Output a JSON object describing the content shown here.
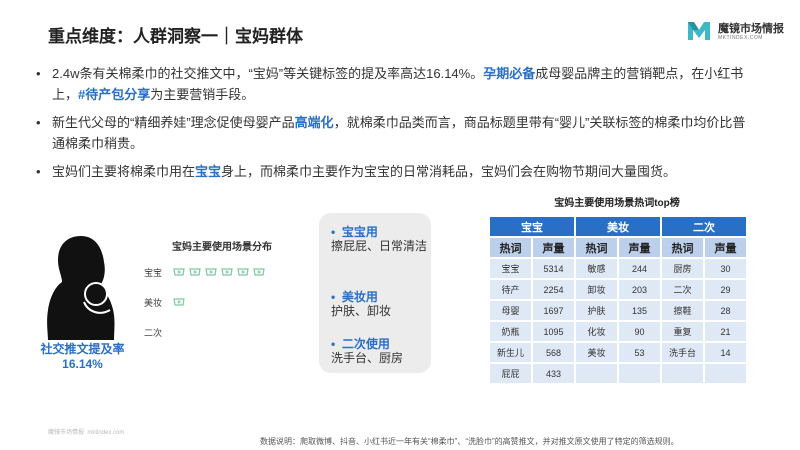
{
  "title": "重点维度：人群洞察一｜宝妈群体",
  "logo": {
    "name": "魔镜市场情报",
    "sub": "MKTINDEX.COM"
  },
  "bullets": [
    {
      "parts": [
        {
          "text": "2.4w条有关棉柔巾的社交推文中，“宝妈”等关键标签的提及率高达16.14%。",
          "hl": false
        },
        {
          "text": "孕期必备",
          "hl": true
        },
        {
          "text": "成母婴品牌主的营销靶点，在小红书上，",
          "hl": false
        },
        {
          "text": "#待产包分享",
          "hl": true
        },
        {
          "text": "为主要营销手段。",
          "hl": false
        }
      ]
    },
    {
      "parts": [
        {
          "text": "新生代父母的“精细养娃”理念促使母婴产品",
          "hl": false
        },
        {
          "text": "高端化",
          "hl": true
        },
        {
          "text": "，就棉柔巾品类而言，商品标题里带有“婴儿”关联标签的棉柔巾均价比普通棉柔巾稍贵。",
          "hl": false
        }
      ]
    },
    {
      "parts": [
        {
          "text": "宝妈们主要将棉柔巾用在",
          "hl": false
        },
        {
          "text": "宝宝",
          "hl": true
        },
        {
          "text": "身上，而棉柔巾主要作为宝宝的日常消耗品，宝妈们会在购物节期间大量囤货。",
          "hl": false
        }
      ]
    }
  ],
  "social": {
    "label": "社交推文提及率",
    "value": "16.14%"
  },
  "distribution": {
    "title": "宝妈主要使用场景分布",
    "rows": [
      {
        "label": "宝宝",
        "icons": 6
      },
      {
        "label": "美妆",
        "icons": 1
      },
      {
        "label": "二次",
        "icons": 0
      }
    ]
  },
  "uses": [
    {
      "head": "宝宝用",
      "text": "擦屁屁、日常清洁"
    },
    {
      "head": "美妆用",
      "text": "护肤、卸妆"
    },
    {
      "head": "二次使用",
      "text": "洗手台、厨房"
    }
  ],
  "table": {
    "title": "宝妈主要使用场景热词top榜",
    "groups": [
      "宝宝",
      "美妆",
      "二次"
    ],
    "headers": [
      "热词",
      "声量",
      "热词",
      "声量",
      "热词",
      "声量"
    ],
    "rows": [
      [
        "宝宝",
        "5314",
        "敏感",
        "244",
        "厨房",
        "30"
      ],
      [
        "待产",
        "2254",
        "卸妆",
        "203",
        "二次",
        "29"
      ],
      [
        "母婴",
        "1697",
        "护肤",
        "135",
        "擦鞋",
        "28"
      ],
      [
        "奶瓶",
        "1095",
        "化妆",
        "90",
        "重复",
        "21"
      ],
      [
        "新生儿",
        "568",
        "美妆",
        "53",
        "洗手台",
        "14"
      ],
      [
        "屁屁",
        "433",
        "",
        "",
        "",
        ""
      ]
    ]
  },
  "footer": {
    "left": "魔镜市场情报: mktindex.com",
    "right": "数据说明：爬取微博、抖音、小红书近一年有关“棉柔巾”、“洗脸巾”的高赞推文，并对推文原文使用了特定的筛选规则。"
  },
  "colors": {
    "accent": "#2a6fc6",
    "header_fill": "#bcd0ec",
    "cell_fill": "#dfe8f5",
    "logo_teal": "#3db8c4"
  }
}
